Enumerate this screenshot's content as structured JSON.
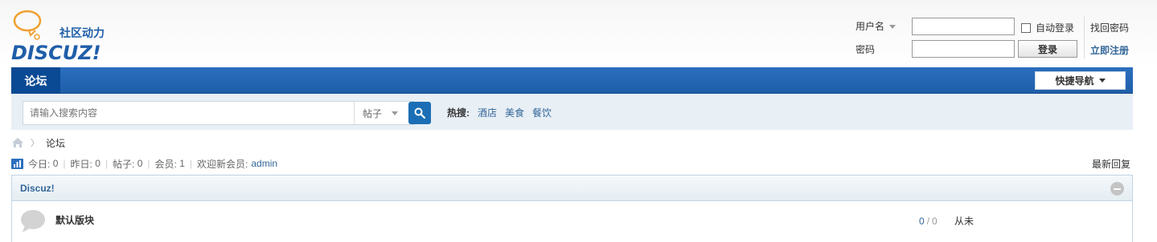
{
  "header": {
    "logo_text": "DISCUZ!",
    "logo_tagline": "社区动力"
  },
  "login": {
    "username_label": "用户名",
    "password_label": "密码",
    "username_value": "",
    "password_value": "",
    "auto_login_label": "自动登录",
    "login_button": "登录",
    "forgot_password": "找回密码",
    "register": "立即注册"
  },
  "nav": {
    "tabs": [
      {
        "label": "论坛"
      }
    ],
    "quick_nav": "快捷导航"
  },
  "search": {
    "placeholder": "请输入搜索内容",
    "type": "帖子",
    "hot_label": "热搜:",
    "hot_terms": [
      "酒店",
      "美食",
      "餐饮"
    ]
  },
  "breadcrumb": {
    "current": "论坛"
  },
  "stats": {
    "today_label": "今日:",
    "today": "0",
    "yesterday_label": "昨日:",
    "yesterday": "0",
    "posts_label": "帖子:",
    "posts": "0",
    "members_label": "会员:",
    "members": "1",
    "welcome_label": "欢迎新会员:",
    "newest_member": "admin",
    "latest_replies": "最新回复"
  },
  "forum": {
    "category": "Discuz!",
    "boards": [
      {
        "name": "默认版块",
        "threads": "0",
        "posts": "0",
        "last_post": "从未"
      }
    ]
  },
  "colors": {
    "nav_blue": "#1f5ea9",
    "nav_active": "#0a4a94",
    "link_blue": "#336699",
    "search_bg": "#e8eff5"
  }
}
